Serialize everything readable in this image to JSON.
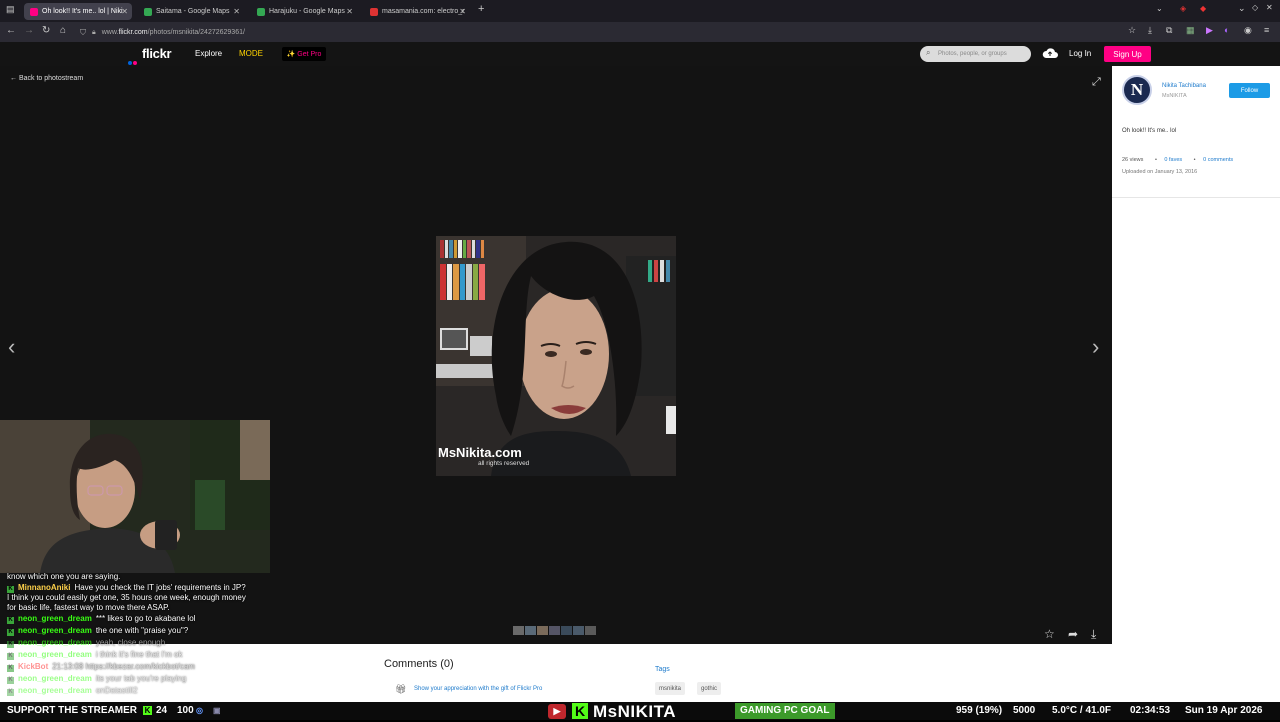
{
  "tabs": [
    {
      "label": "Oh look!! It's me.. lol | Niki",
      "fav": "#ff0084",
      "active": true
    },
    {
      "label": "Saitama - Google Maps",
      "fav": "#34a853",
      "active": false
    },
    {
      "label": "Harajuku - Google Maps",
      "fav": "#34a853",
      "active": false
    },
    {
      "label": "masamania.com: electro_r",
      "fav": "#d33",
      "active": false
    }
  ],
  "url": {
    "prefix": "www.",
    "host": "flickr.com",
    "path": "/photos/msnikita/24272629361/"
  },
  "flickr": {
    "logo": "flickr",
    "nav": {
      "explore": "Explore",
      "mode": "MODE",
      "get_pro": "✨ Get Pro"
    },
    "search_placeholder": "Photos, people, or groups",
    "login": "Log In",
    "signup": "Sign Up",
    "back": "Back to photostream",
    "photo_watermark": "MsNikita.com",
    "photo_rights": "all rights reserved",
    "owner": {
      "name": "Nikita Tachibana",
      "handle": "MsNIKITA",
      "avatar_letter": "N",
      "follow": "Follow"
    },
    "photo_title": "Oh look!! It's me.. lol",
    "stats": {
      "views": "26 views",
      "faves": "0 faves",
      "comments": "0 comments"
    },
    "uploaded": "Uploaded on January 13, 2016",
    "comments_header": "Comments (0)",
    "gift_text": "Show your appreciation with the gift of Flickr Pro",
    "tags_header": "Tags",
    "tags": [
      "msnikita",
      "gothic"
    ]
  },
  "chat": [
    {
      "user": "",
      "text": "know which one you are saying.",
      "color": "#fff"
    },
    {
      "user": "MinnanoAniki",
      "text": "Have you check the IT jobs' requirements in JP? I think you could easily get one, 35 hours one week, enough money for basic life, fastest way to move there ASAP.",
      "color": "#ffd24a"
    },
    {
      "user": "neon_green_dream",
      "text": "*** likes to go to akabane lol",
      "color": "#39ff14"
    },
    {
      "user": "neon_green_dream",
      "text": "the one with \"praise you\"?",
      "color": "#39ff14"
    },
    {
      "user": "neon_green_dream",
      "text": "yeah, close enough",
      "color": "#39ff14"
    },
    {
      "user": "neon_green_dream",
      "text": "i think it's fine that I'm ok",
      "color": "#39ff14"
    },
    {
      "user": "KickBot",
      "text": "21:13:08 https://kbezar.com/kickbot/cam",
      "color": "#ff4a4a"
    },
    {
      "user": "neon_green_dream",
      "text": "its your tab you're playing",
      "color": "#39ff14"
    },
    {
      "user": "neon_green_dream",
      "text": "onDatastill2",
      "color": "#39ff14"
    }
  ],
  "overlay": {
    "support": "SUPPORT THE STREAMER",
    "count1": "24",
    "count2": "100",
    "brand": "MsNIKITA",
    "goal": "GAMING PC GOAL",
    "goal_progress": "959 (19%)",
    "goal_target": "5000",
    "temp": "5.0°C / 41.0F",
    "time": "02:34:53",
    "date": "Sun 19 Apr 2026"
  }
}
